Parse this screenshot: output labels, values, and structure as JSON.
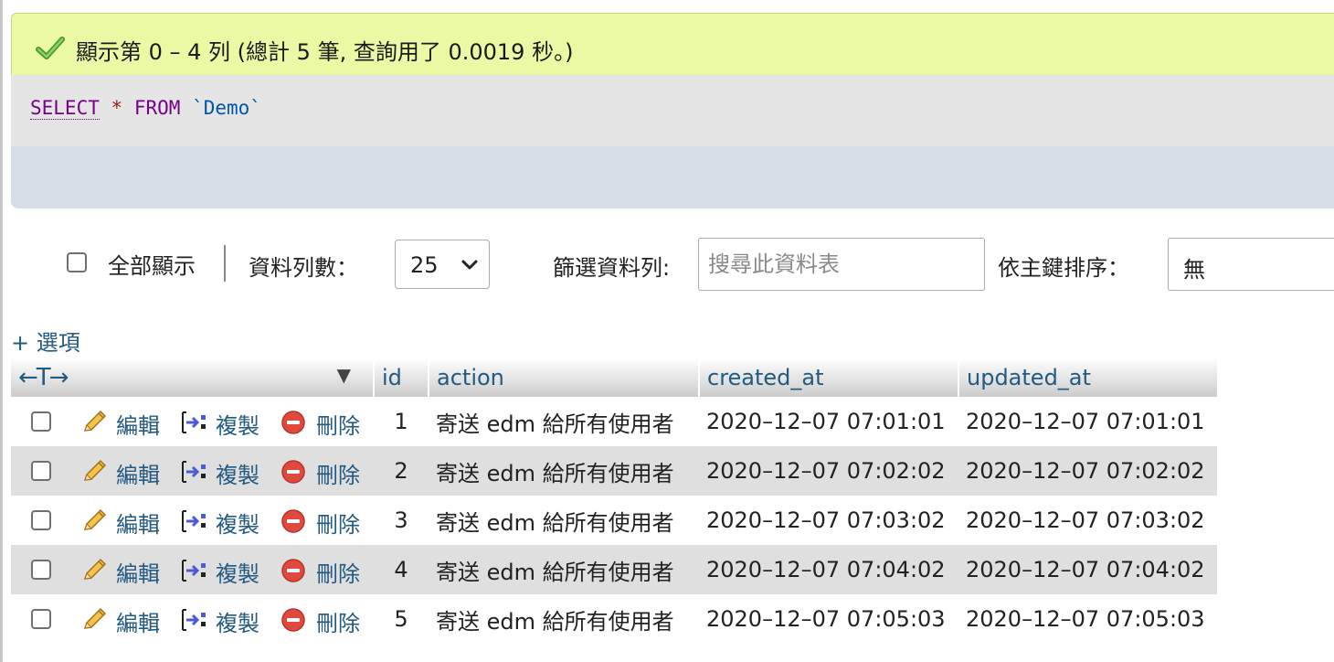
{
  "banner": {
    "message": "顯示第 0 – 4 列 (總計 5 筆, 查詢用了 0.0019 秒。)"
  },
  "sql": {
    "select": "SELECT",
    "star": "*",
    "from": "FROM",
    "table": "`Demo`"
  },
  "controls": {
    "show_all_label": "全部顯示",
    "rows_label": "資料列數：",
    "rows_value": "25",
    "filter_label": "篩選資料列:",
    "filter_placeholder": "搜尋此資料表",
    "sort_label": "依主鍵排序：",
    "sort_value": "無"
  },
  "options_link": "+ 選項",
  "table": {
    "columns": [
      "id",
      "action",
      "created_at",
      "updated_at"
    ],
    "actions": {
      "edit": "編輯",
      "copy": "複製",
      "delete": "刪除"
    },
    "rows": [
      {
        "id": "1",
        "action": "寄送 edm 給所有使用者",
        "created_at": "2020–12–07 07:01:01",
        "updated_at": "2020–12–07 07:01:01"
      },
      {
        "id": "2",
        "action": "寄送 edm 給所有使用者",
        "created_at": "2020–12–07 07:02:02",
        "updated_at": "2020–12–07 07:02:02"
      },
      {
        "id": "3",
        "action": "寄送 edm 給所有使用者",
        "created_at": "2020–12–07 07:03:02",
        "updated_at": "2020–12–07 07:03:02"
      },
      {
        "id": "4",
        "action": "寄送 edm 給所有使用者",
        "created_at": "2020–12–07 07:04:02",
        "updated_at": "2020–12–07 07:04:02"
      },
      {
        "id": "5",
        "action": "寄送 edm 給所有使用者",
        "created_at": "2020–12–07 07:05:03",
        "updated_at": "2020–12–07 07:05:03"
      }
    ]
  },
  "icons": {
    "success": "check-icon",
    "edit": "pencil-icon",
    "copy": "insert-row-icon",
    "delete": "minus-circle-icon"
  },
  "colors": {
    "banner_bg": "#ebf8a4",
    "link": "#235a81",
    "keyword": "#770088",
    "delete_red": "#e0493e"
  }
}
